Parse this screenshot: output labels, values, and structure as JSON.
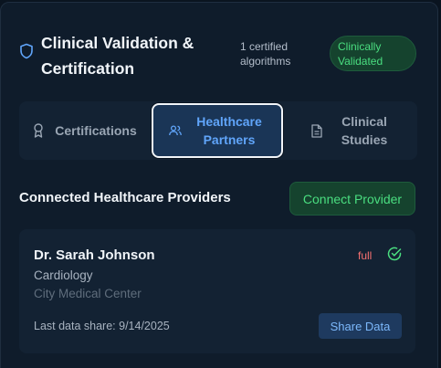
{
  "header": {
    "title": "Clinical Validation & Certification",
    "icon": "shield-icon",
    "cert_count": "1 certified algorithms",
    "status_badge": "Clinically Validated"
  },
  "tabs": [
    {
      "label": "Certifications",
      "icon": "award-icon",
      "active": false
    },
    {
      "label": "Healthcare Partners",
      "icon": "users-icon",
      "active": true
    },
    {
      "label": "Clinical Studies",
      "icon": "document-icon",
      "active": false
    }
  ],
  "providers_section": {
    "title": "Connected Healthcare Providers",
    "connect_label": "Connect Provider"
  },
  "providers": [
    {
      "name": "Dr. Sarah Johnson",
      "specialty": "Cardiology",
      "organization": "City Medical Center",
      "access_level": "full",
      "last_share": "Last data share: 9/14/2025",
      "share_label": "Share Data"
    }
  ],
  "colors": {
    "accent_blue": "#60a5fa",
    "success_green": "#4ade80",
    "alert_red": "#f87171",
    "background": "#0f1c2b"
  }
}
